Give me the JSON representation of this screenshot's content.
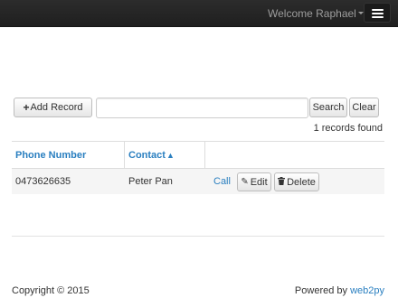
{
  "navbar": {
    "welcome_text": "Welcome Raphael",
    "icons": {
      "dropdown": "caret-down-icon",
      "menu": "hamburger-menu-icon"
    },
    "background_color": "#222222"
  },
  "toolbar": {
    "add_record_label": "Add Record",
    "add_icon": "plus-icon",
    "search_value": "",
    "search_button_label": "Search",
    "clear_button_label": "Clear"
  },
  "records_found": "1 records found",
  "table": {
    "columns": [
      {
        "label": "Phone Number",
        "sortable": true
      },
      {
        "label": "Contact",
        "sortable": true,
        "sort_indicator": "▲"
      },
      {
        "label": "",
        "sortable": false
      }
    ],
    "rows": [
      {
        "phone": "0473626635",
        "contact": "Peter Pan",
        "call_label": "Call",
        "edit_label": "Edit",
        "delete_label": "Delete"
      }
    ],
    "icons": {
      "edit": "pencil-icon",
      "delete": "trash-icon"
    }
  },
  "footer": {
    "copyright": "Copyright © 2015",
    "powered_prefix": "Powered by",
    "powered_link": "web2py"
  },
  "colors": {
    "link": "#2a7fc0",
    "row_background": "#f5f5f5"
  }
}
